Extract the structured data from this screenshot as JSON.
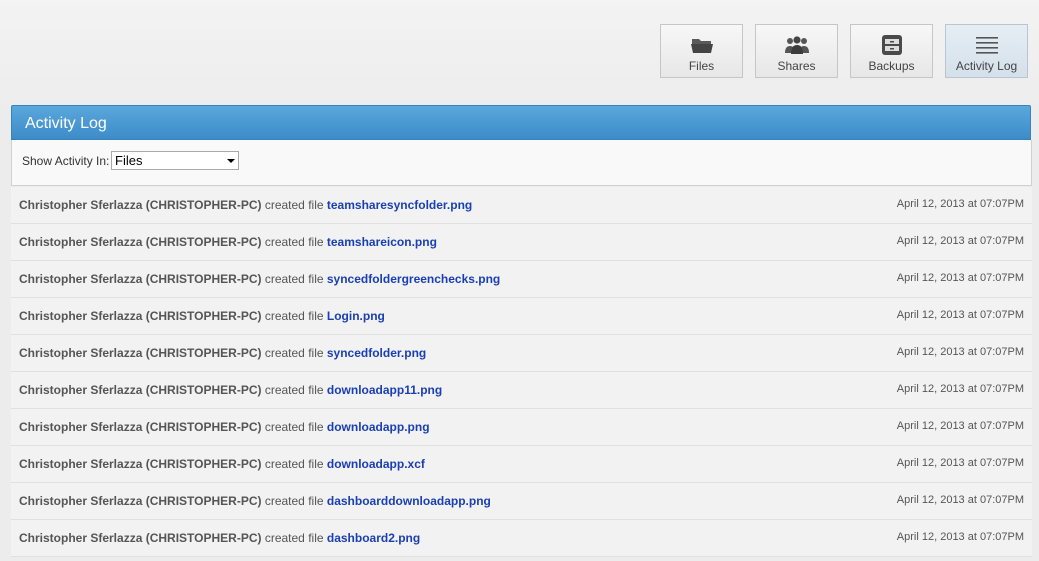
{
  "nav": {
    "files_label": "Files",
    "shares_label": "Shares",
    "backups_label": "Backups",
    "activity_label": "Activity Log"
  },
  "panel": {
    "title": "Activity Log",
    "filter_label": "Show Activity In:",
    "filter_value": "Files"
  },
  "activity": [
    {
      "user": "Christopher Sferlazza (CHRISTOPHER-PC)",
      "action": "created file",
      "file": "teamsharesyncfolder.png",
      "time": "April 12, 2013 at 07:07PM"
    },
    {
      "user": "Christopher Sferlazza (CHRISTOPHER-PC)",
      "action": "created file",
      "file": "teamshareicon.png",
      "time": "April 12, 2013 at 07:07PM"
    },
    {
      "user": "Christopher Sferlazza (CHRISTOPHER-PC)",
      "action": "created file",
      "file": "syncedfoldergreenchecks.png",
      "time": "April 12, 2013 at 07:07PM"
    },
    {
      "user": "Christopher Sferlazza (CHRISTOPHER-PC)",
      "action": "created file",
      "file": "Login.png",
      "time": "April 12, 2013 at 07:07PM"
    },
    {
      "user": "Christopher Sferlazza (CHRISTOPHER-PC)",
      "action": "created file",
      "file": "syncedfolder.png",
      "time": "April 12, 2013 at 07:07PM"
    },
    {
      "user": "Christopher Sferlazza (CHRISTOPHER-PC)",
      "action": "created file",
      "file": "downloadapp11.png",
      "time": "April 12, 2013 at 07:07PM"
    },
    {
      "user": "Christopher Sferlazza (CHRISTOPHER-PC)",
      "action": "created file",
      "file": "downloadapp.png",
      "time": "April 12, 2013 at 07:07PM"
    },
    {
      "user": "Christopher Sferlazza (CHRISTOPHER-PC)",
      "action": "created file",
      "file": "downloadapp.xcf",
      "time": "April 12, 2013 at 07:07PM"
    },
    {
      "user": "Christopher Sferlazza (CHRISTOPHER-PC)",
      "action": "created file",
      "file": "dashboarddownloadapp.png",
      "time": "April 12, 2013 at 07:07PM"
    },
    {
      "user": "Christopher Sferlazza (CHRISTOPHER-PC)",
      "action": "created file",
      "file": "dashboard2.png",
      "time": "April 12, 2013 at 07:07PM"
    }
  ],
  "colors": {
    "header_blue": "#4a9ad4",
    "link_blue": "#1a3fb3"
  }
}
